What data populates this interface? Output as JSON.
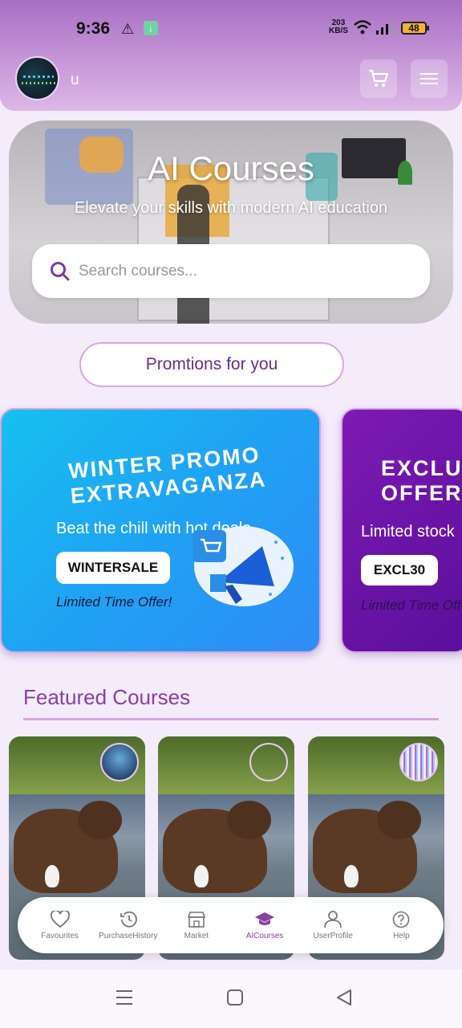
{
  "status_bar": {
    "time": "9:36",
    "net_speed_top": "203",
    "net_speed_unit": "KB/S",
    "battery": "48"
  },
  "header": {
    "username": "u"
  },
  "hero": {
    "title": "AI Courses",
    "subtitle": "Elevate your skills with modern AI education"
  },
  "search": {
    "placeholder": "Search courses..."
  },
  "promotions_button": "Promtions for you",
  "promos": [
    {
      "title": "WINTER PROMO EXTRAVAGANZA",
      "desc": "Beat the chill with hot deals",
      "code": "WINTERSALE",
      "note": "Limited Time Offer!"
    },
    {
      "title": "EXCLUSIVE OFFER",
      "desc": "Limited stock",
      "code": "EXCL30",
      "note": "Limited Time Offer!"
    }
  ],
  "featured": {
    "title": "Featured Courses"
  },
  "bottom_nav": [
    {
      "label": "Favourites",
      "icon": "heart-icon"
    },
    {
      "label": "PurchaseHistory",
      "icon": "history-icon"
    },
    {
      "label": "Market",
      "icon": "store-icon"
    },
    {
      "label": "AICourses",
      "icon": "graduation-cap-icon",
      "active": true
    },
    {
      "label": "UserProfile",
      "icon": "user-icon"
    },
    {
      "label": "Help",
      "icon": "help-icon"
    }
  ],
  "colors": {
    "accent": "#8a3fa3",
    "header_top": "#a86fc4",
    "promo_blue": "#1fa2f3",
    "promo_purple": "#6a14a6"
  }
}
